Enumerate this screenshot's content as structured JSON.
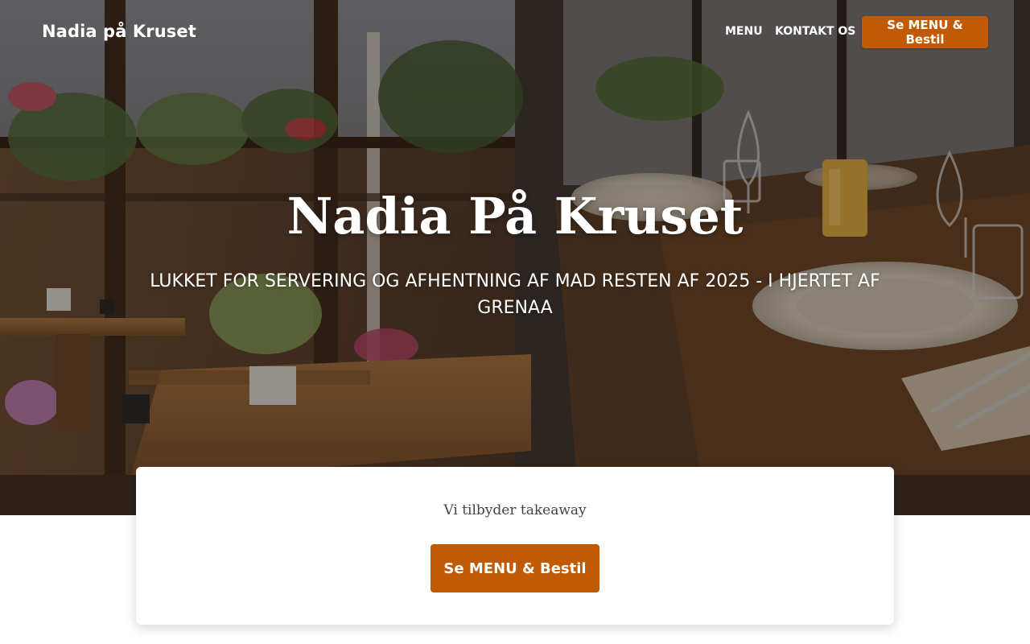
{
  "navbar": {
    "brand": "Nadia på Kruset",
    "links": [
      "MENU",
      "KONTAKT OS"
    ],
    "cta_label": "Se MENU & Bestil"
  },
  "hero": {
    "title": "Nadia På Kruset",
    "subtitle": "LUKKET FOR SERVERING OG AFHENTNING AF MAD RESTEN AF 2025 - I HJERTET AF GRENAA"
  },
  "card": {
    "text": "Vi tilbyder takeaway",
    "cta_label": "Se MENU & Bestil"
  },
  "colors": {
    "accent": "#c05a05",
    "text_white": "#ffffff",
    "card_text": "#444444"
  }
}
